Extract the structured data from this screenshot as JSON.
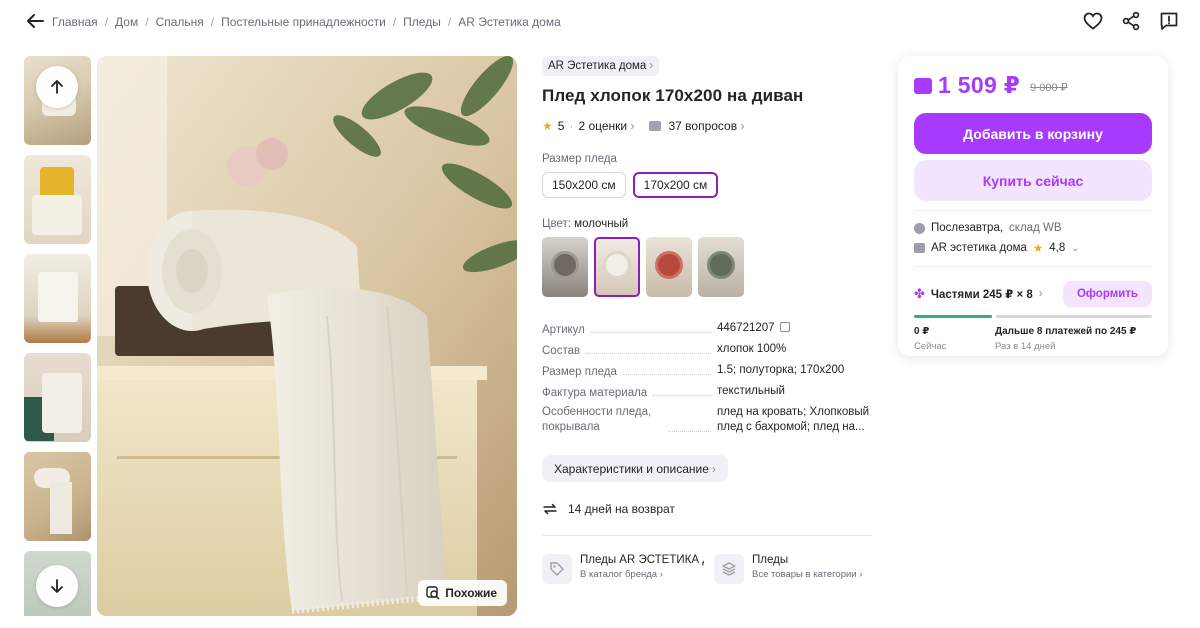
{
  "breadcrumb": [
    "Главная",
    "Дом",
    "Спальня",
    "Постельные принадлежности",
    "Пледы",
    "AR Эстетика дома"
  ],
  "brand_chip": "AR Эстетика дома",
  "title": "Плед хлопок 170x200 на диван",
  "rating": {
    "value": "5",
    "count": "2 оценки",
    "questions": "37 вопросов"
  },
  "size": {
    "label": "Размер пледа",
    "options": [
      "150x200 см",
      "170x200 см"
    ],
    "selected": "170x200 см"
  },
  "color": {
    "label": "Цвет:",
    "value": "молочный",
    "swatch_count": 4,
    "selected_index": 1
  },
  "specs": [
    {
      "key": "Артикул",
      "value": "446721207"
    },
    {
      "key": "Состав",
      "value": "хлопок 100%"
    },
    {
      "key": "Размер пледа",
      "value": "1.5; полуторка; 170x200"
    },
    {
      "key": "Фактура материала",
      "value": "текстильный"
    },
    {
      "key": "Особенности пледа, покрывала",
      "value": "плед на кровать; Хлопковый плед с бахромой; плед на..."
    }
  ],
  "chars_button": "Характеристики и описание",
  "return_text": "14 дней на возврат",
  "categories": [
    {
      "title": "Пледы AR ЭСТЕТИКА Д",
      "sub": "В каталог бренда"
    },
    {
      "title": "Пледы",
      "sub": "Все товары в категории"
    }
  ],
  "similar_button": "Похожие",
  "price": {
    "current": "1 509 ₽",
    "old": "9 000 ₽"
  },
  "cart_button": "Добавить в корзину",
  "buy_button": "Купить сейчас",
  "delivery": {
    "when": "Послезавтра,",
    "where": "склад WB"
  },
  "store": {
    "name": "AR эстетика дома",
    "rating": "4,8"
  },
  "installments": {
    "label": "Частями 245 ₽ × 8",
    "button": "Оформить",
    "now_value": "0 ₽",
    "now_sub": "Сейчас",
    "later_value": "Дальше 8 платежей по 245 ₽",
    "later_sub": "Раз в 14 дней"
  },
  "colors": {
    "accent": "#a73afd",
    "selected_outline": "#8b1fb6",
    "star": "#f5a623",
    "progress": "#2cb56c"
  }
}
